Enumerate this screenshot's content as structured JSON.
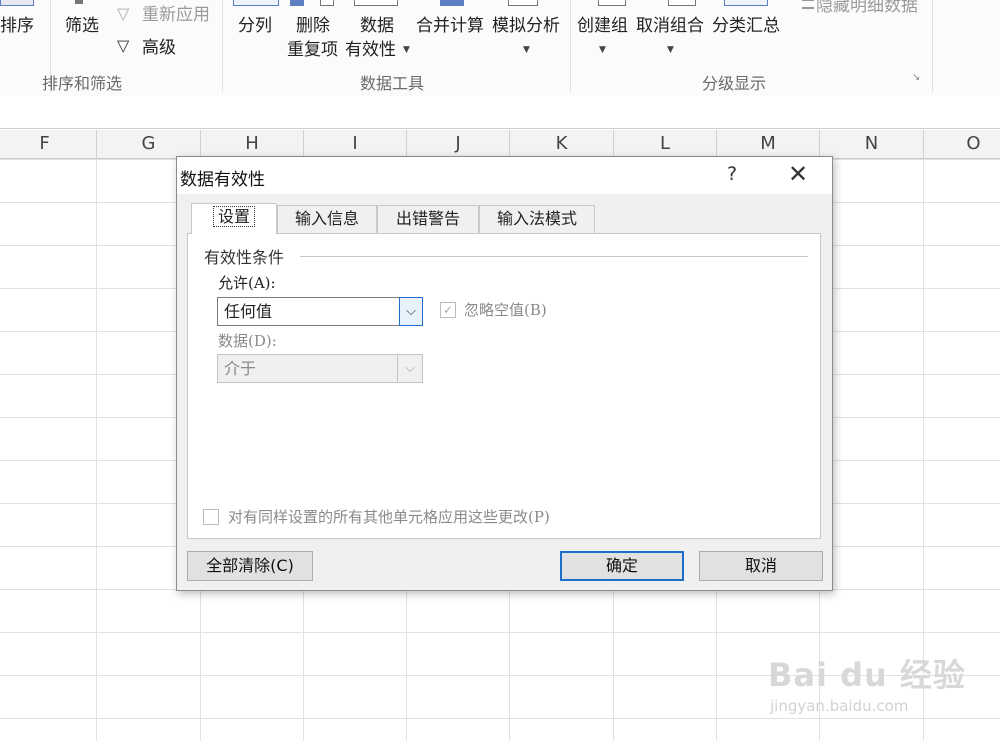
{
  "ribbon": {
    "sort_label": "排序",
    "filter_label": "筛选",
    "reapply_label": "重新应用",
    "advanced_label": "高级",
    "group_sort_filter": "排序和筛选",
    "text_to_columns_label": "分列",
    "remove_dup_line1": "删除",
    "remove_dup_line2": "重复项",
    "data_validation_line1": "数据",
    "data_validation_line2": "有效性",
    "consolidate_label": "合并计算",
    "whatif_label": "模拟分析",
    "group_data_tools": "数据工具",
    "create_group_label": "创建组",
    "ungroup_label": "取消组合",
    "subtotal_label": "分类汇总",
    "hide_detail_label": "隐藏明细数据",
    "group_outline": "分级显示"
  },
  "columns": [
    "F",
    "G",
    "H",
    "I",
    "J",
    "K",
    "L",
    "M",
    "N",
    "O"
  ],
  "dialog": {
    "title": "数据有效性",
    "help": "?",
    "close": "✕",
    "tabs": [
      {
        "label": "设置",
        "active": true
      },
      {
        "label": "输入信息",
        "active": false
      },
      {
        "label": "出错警告",
        "active": false
      },
      {
        "label": "输入法模式",
        "active": false
      }
    ],
    "group_title": "有效性条件",
    "allow_label": "允许(A):",
    "allow_value": "任何值",
    "ignore_blank_label": "忽略空值(B)",
    "ignore_blank_checked": true,
    "data_label": "数据(D):",
    "data_value": "介于",
    "apply_all_label": "对有同样设置的所有其他单元格应用这些更改(P)",
    "apply_all_checked": false,
    "clear_all_button": "全部清除(C)",
    "ok_button": "确定",
    "cancel_button": "取消"
  },
  "watermark": {
    "brand": "Bai du 经验",
    "url": "jingyan.baidu.com"
  },
  "colors": {
    "accent": "#1e6fc9",
    "dialog_bg": "#f0f0f0",
    "disabled_text": "#8a8a8a"
  }
}
